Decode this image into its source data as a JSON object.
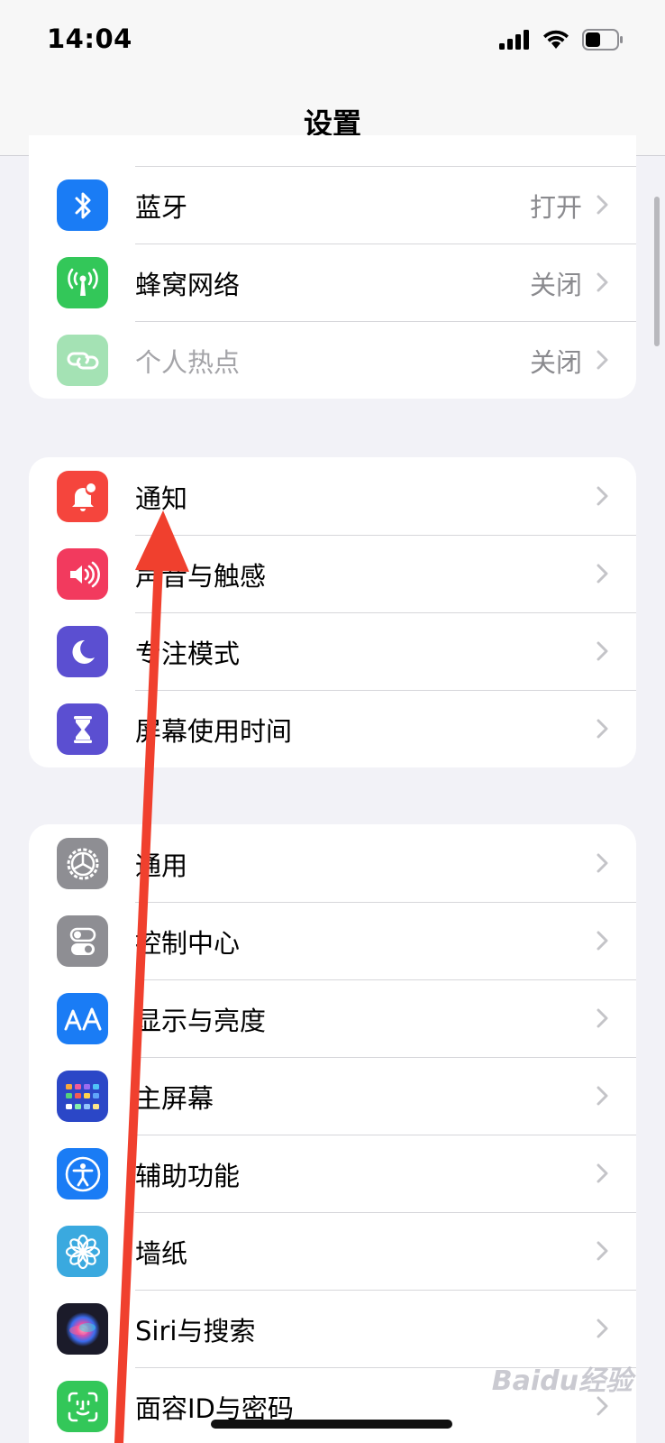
{
  "status": {
    "time": "14:04"
  },
  "nav": {
    "title": "设置"
  },
  "groups": [
    {
      "items": [
        {
          "label": "蓝牙",
          "value": "打开"
        },
        {
          "label": "蜂窝网络",
          "value": "关闭"
        },
        {
          "label": "个人热点",
          "value": "关闭"
        }
      ]
    },
    {
      "items": [
        {
          "label": "通知"
        },
        {
          "label": "声音与触感"
        },
        {
          "label": "专注模式"
        },
        {
          "label": "屏幕使用时间"
        }
      ]
    },
    {
      "items": [
        {
          "label": "通用"
        },
        {
          "label": "控制中心"
        },
        {
          "label": "显示与亮度"
        },
        {
          "label": "主屏幕"
        },
        {
          "label": "辅助功能"
        },
        {
          "label": "墙纸"
        },
        {
          "label": "Siri与搜索"
        },
        {
          "label": "面容ID与密码"
        }
      ]
    }
  ],
  "icons": {
    "bluetooth": "bluetooth-icon",
    "cellular": "cellular-antenna-icon",
    "hotspot": "personal-hotspot-icon",
    "notifications": "notification-bell-icon",
    "sounds": "speaker-icon",
    "focus": "moon-icon",
    "screentime": "hourglass-icon",
    "general": "gear-icon",
    "control": "toggle-switches-icon",
    "display": "text-size-aa-icon",
    "homescreen": "app-grid-icon",
    "accessibility": "accessibility-person-icon",
    "wallpaper": "flower-icon",
    "siri": "siri-orb-icon",
    "faceid": "face-id-icon"
  },
  "colors": {
    "bluetooth": "#1a7cf5",
    "cellular": "#33c759",
    "hotspot": "#a4e2b4",
    "notifications": "#f5453d",
    "sounds": "#f23a5e",
    "focus": "#5b4fd1",
    "screentime": "#5b4fd1",
    "general": "#8e8e93",
    "control": "#8e8e93",
    "display": "#1a7cf5",
    "homescreen": "#2b47c7",
    "accessibility": "#1a7cf5",
    "wallpaper": "#3aa9df",
    "siri": "#1b1b2a",
    "faceid": "#33c759",
    "annotation_arrow": "#f0402e"
  },
  "watermark": "Baidu经验"
}
